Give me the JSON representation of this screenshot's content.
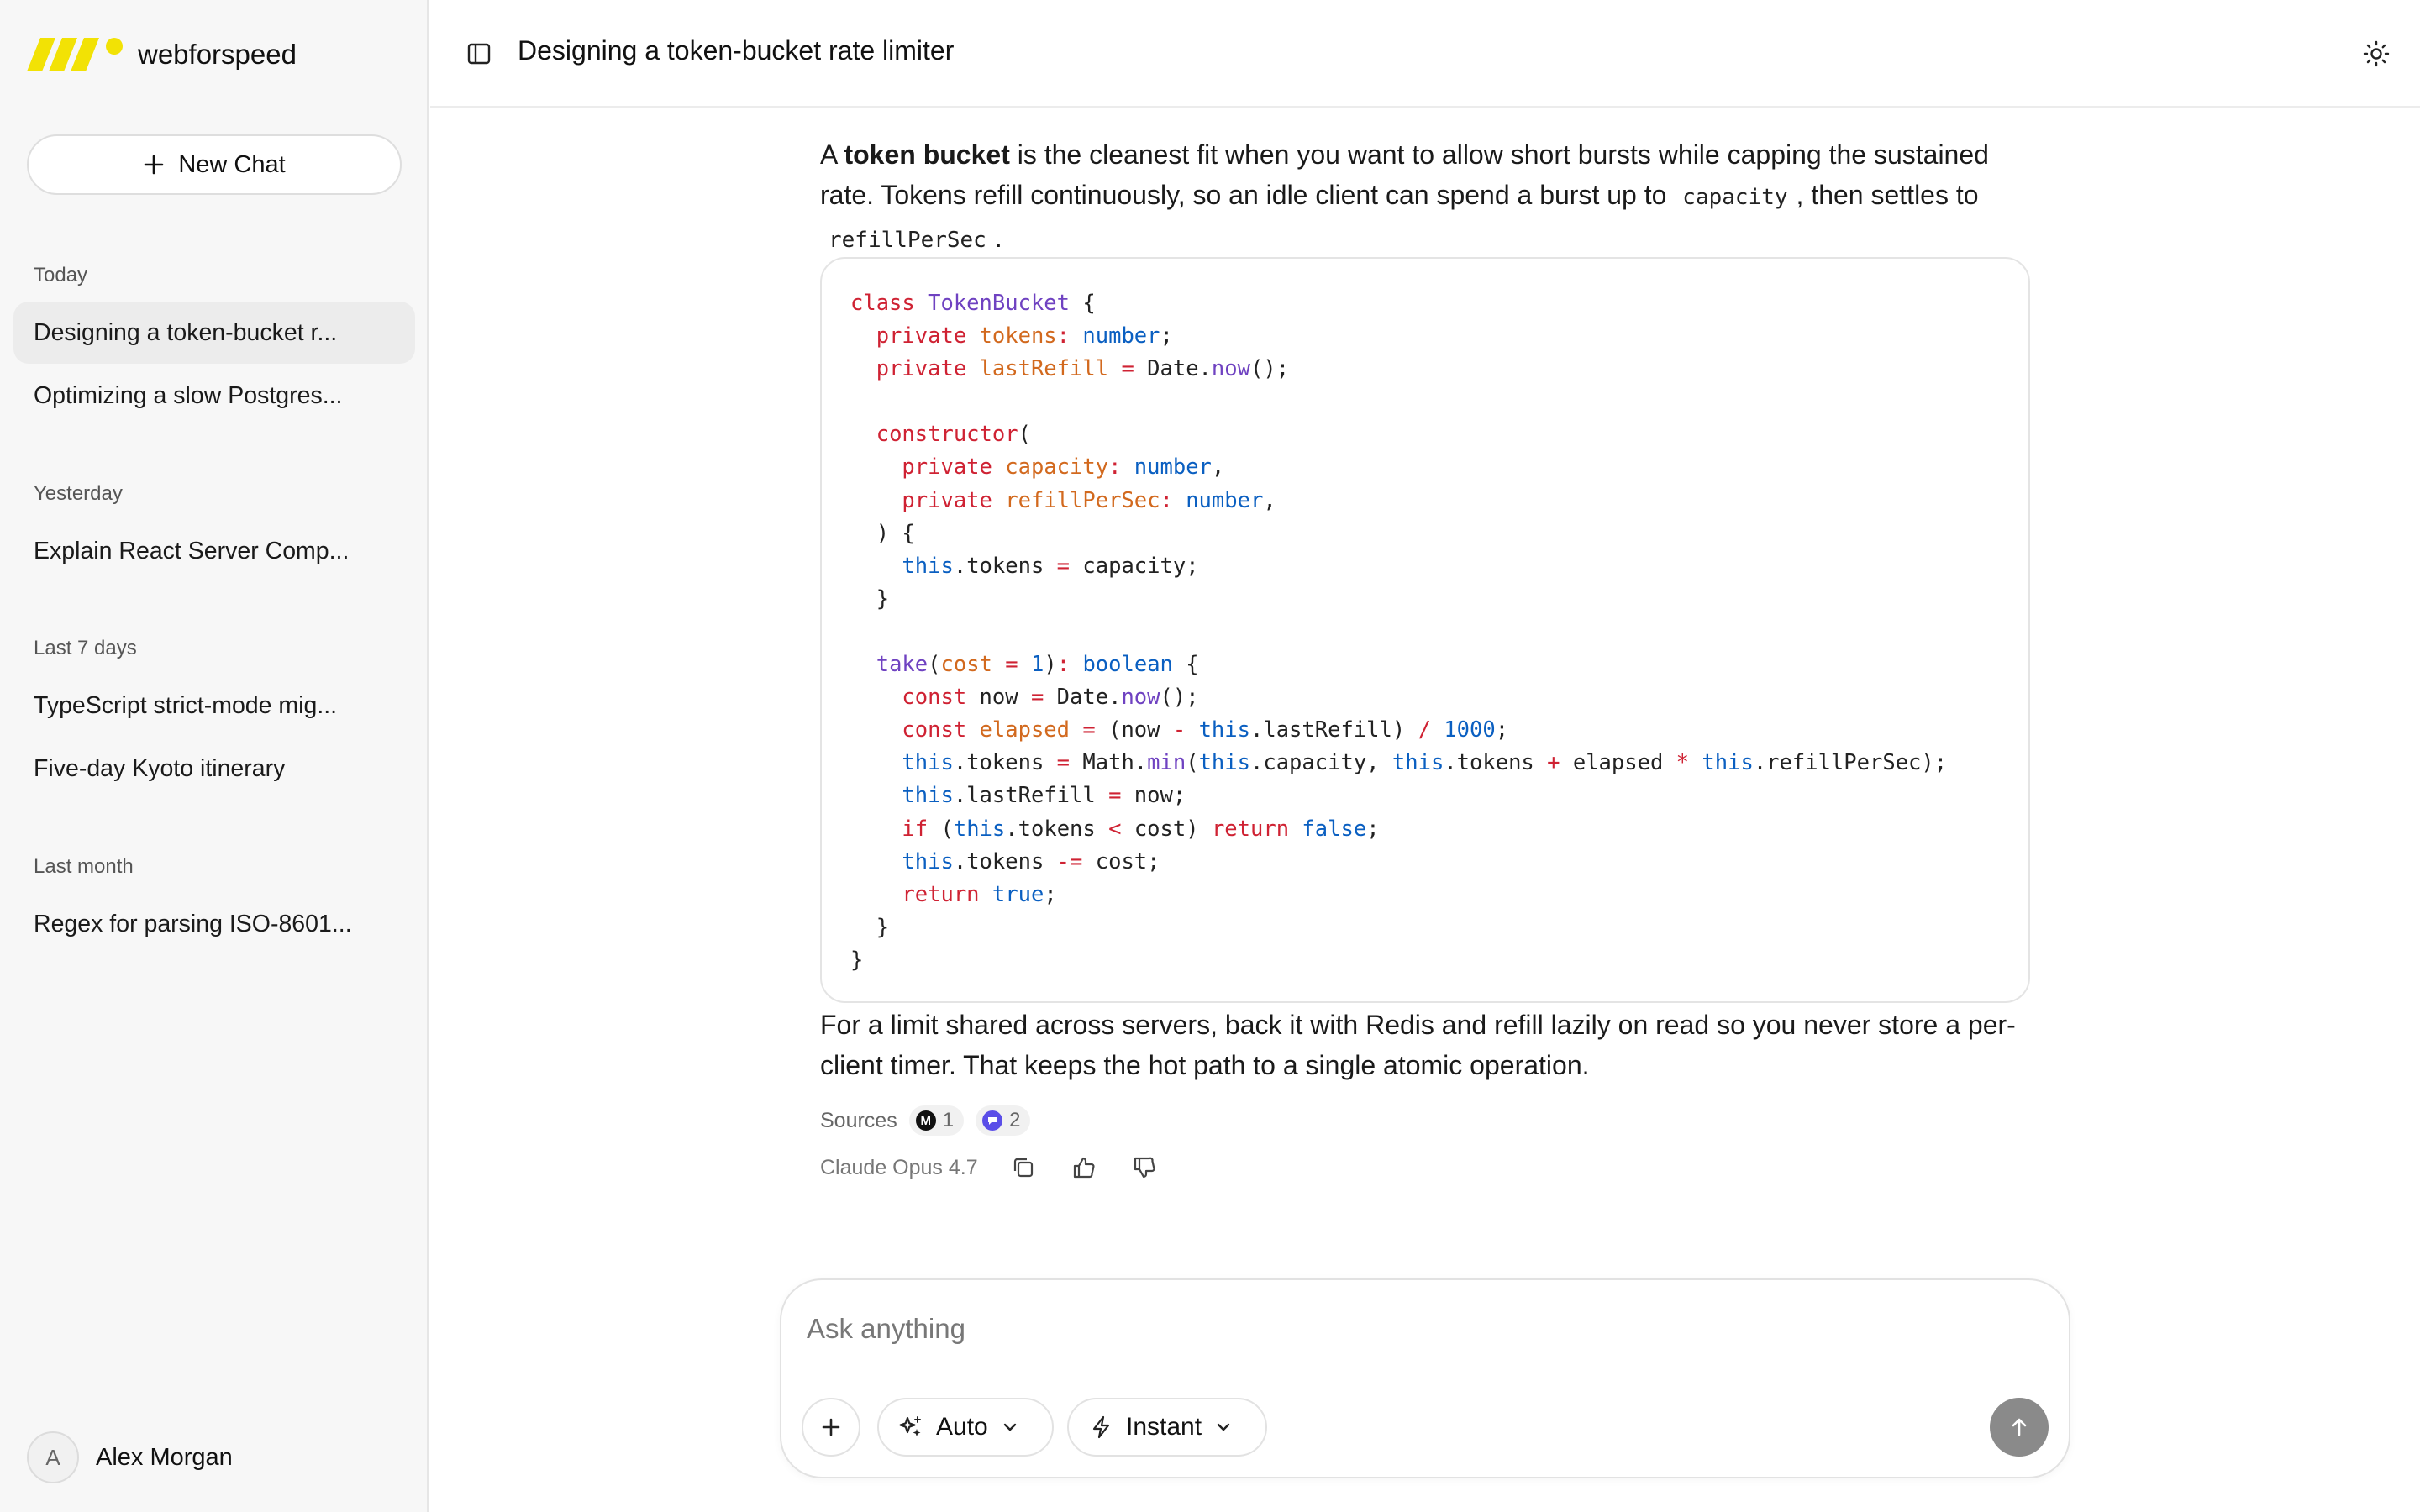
{
  "brand": {
    "name": "webforspeed",
    "logo_color": "#f2e205"
  },
  "sidebar": {
    "new_chat_label": "New Chat",
    "groups": [
      {
        "label": "Today",
        "items": [
          "Designing a token-bucket r...",
          "Optimizing a slow Postgres..."
        ]
      },
      {
        "label": "Yesterday",
        "items": [
          "Explain React Server Comp..."
        ]
      },
      {
        "label": "Last 7 days",
        "items": [
          "TypeScript strict-mode mig...",
          "Five-day Kyoto itinerary"
        ]
      },
      {
        "label": "Last month",
        "items": [
          "Regex for parsing ISO-8601..."
        ]
      }
    ],
    "user": {
      "initial": "A",
      "name": "Alex Morgan"
    }
  },
  "header": {
    "title": "Designing a token-bucket rate limiter"
  },
  "message": {
    "p1_a": "A ",
    "p1_bold": "token bucket",
    "p1_b": " is the cleanest fit when you want to allow short bursts while capping the sustained rate. Tokens refill continuously, so an idle client can spend a burst up to ",
    "p1_code1": "capacity",
    "p1_c": ", then settles to ",
    "p1_code2": "refillPerSec",
    "p1_d": ".",
    "code": [
      "class TokenBucket {",
      "  private tokens: number;",
      "  private lastRefill = Date.now();",
      "",
      "  constructor(",
      "    private capacity: number,",
      "    private refillPerSec: number,",
      "  ) {",
      "    this.tokens = capacity;",
      "  }",
      "",
      "  take(cost = 1): boolean {",
      "    const now = Date.now();",
      "    const elapsed = (now - this.lastRefill) / 1000;",
      "    this.tokens = Math.min(this.capacity, this.tokens + elapsed * this.refillPerSec);",
      "    this.lastRefill = now;",
      "    if (this.tokens < cost) return false;",
      "    this.tokens -= cost;",
      "    return true;",
      "  }",
      "}"
    ],
    "p2": "For a limit shared across servers, back it with Redis and refill lazily on read so you never store a per-client timer. That keeps the hot path to a single atomic operation.",
    "sources_label": "Sources",
    "sources": [
      {
        "icon": "m-logo-icon",
        "letter": "M",
        "count": "1",
        "color": "#111111"
      },
      {
        "icon": "chat-bubble-icon",
        "letter": "",
        "count": "2",
        "color": "#5b4ee8"
      }
    ],
    "model": "Claude Opus 4.7"
  },
  "composer": {
    "placeholder": "Ask anything",
    "mode_label": "Auto",
    "speed_label": "Instant"
  }
}
